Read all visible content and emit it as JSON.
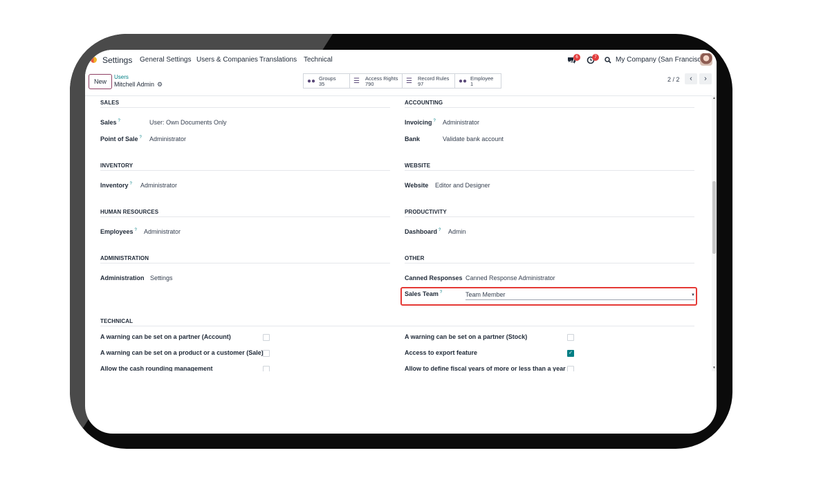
{
  "nav": {
    "app_title": "Settings",
    "menu": [
      "General Settings",
      "Users & Companies",
      "Translations",
      "Technical"
    ],
    "messages_count": "6",
    "activities_count": "7",
    "company": "My Company (San Francisco)"
  },
  "control": {
    "new_label": "New",
    "breadcrumb_parent": "Users",
    "breadcrumb_current": "Mitchell Admin",
    "pager": "2 / 2",
    "stats": [
      {
        "label": "Groups",
        "count": "35",
        "icon": "users-icon"
      },
      {
        "label": "Access Rights",
        "count": "790",
        "icon": "list-icon"
      },
      {
        "label": "Record Rules",
        "count": "97",
        "icon": "list-icon"
      },
      {
        "label": "Employee",
        "count": "1",
        "icon": "users-icon"
      }
    ]
  },
  "sections": {
    "sales": {
      "title": "SALES",
      "fields": [
        {
          "label": "Sales",
          "help": "?",
          "value": "User: Own Documents Only"
        },
        {
          "label": "Point of Sale",
          "help": "?",
          "value": "Administrator"
        }
      ]
    },
    "accounting": {
      "title": "ACCOUNTING",
      "fields": [
        {
          "label": "Invoicing",
          "help": "?",
          "value": "Administrator"
        },
        {
          "label": "Bank",
          "value": "Validate bank account"
        }
      ]
    },
    "inventory": {
      "title": "INVENTORY",
      "fields": [
        {
          "label": "Inventory",
          "help": "?",
          "value": "Administrator"
        }
      ]
    },
    "website": {
      "title": "WEBSITE",
      "fields": [
        {
          "label": "Website",
          "value": "Editor and Designer"
        }
      ]
    },
    "human_resources": {
      "title": "HUMAN RESOURCES",
      "fields": [
        {
          "label": "Employees",
          "help": "?",
          "value": "Administrator"
        }
      ]
    },
    "productivity": {
      "title": "PRODUCTIVITY",
      "fields": [
        {
          "label": "Dashboard",
          "help": "?",
          "value": "Admin"
        }
      ]
    },
    "administration": {
      "title": "ADMINISTRATION",
      "fields": [
        {
          "label": "Administration",
          "value": "Settings"
        }
      ]
    },
    "other": {
      "title": "OTHER",
      "fields": [
        {
          "label": "Canned Responses",
          "value": "Canned Response Administrator"
        },
        {
          "label": "Sales Team",
          "help": "?",
          "value": "Team Member"
        }
      ]
    },
    "technical": {
      "title": "TECHNICAL",
      "left": [
        {
          "label": "A warning can be set on a partner (Account)",
          "checked": false
        },
        {
          "label": "A warning can be set on a product or a customer (Sale)",
          "checked": false
        },
        {
          "label": "Allow the cash rounding management",
          "checked": false
        }
      ],
      "right": [
        {
          "label": "A warning can be set on a partner (Stock)",
          "checked": false
        },
        {
          "label": "Access to export feature",
          "checked": true
        },
        {
          "label": "Allow to define fiscal years of more or less than a year",
          "checked": false
        }
      ]
    }
  }
}
